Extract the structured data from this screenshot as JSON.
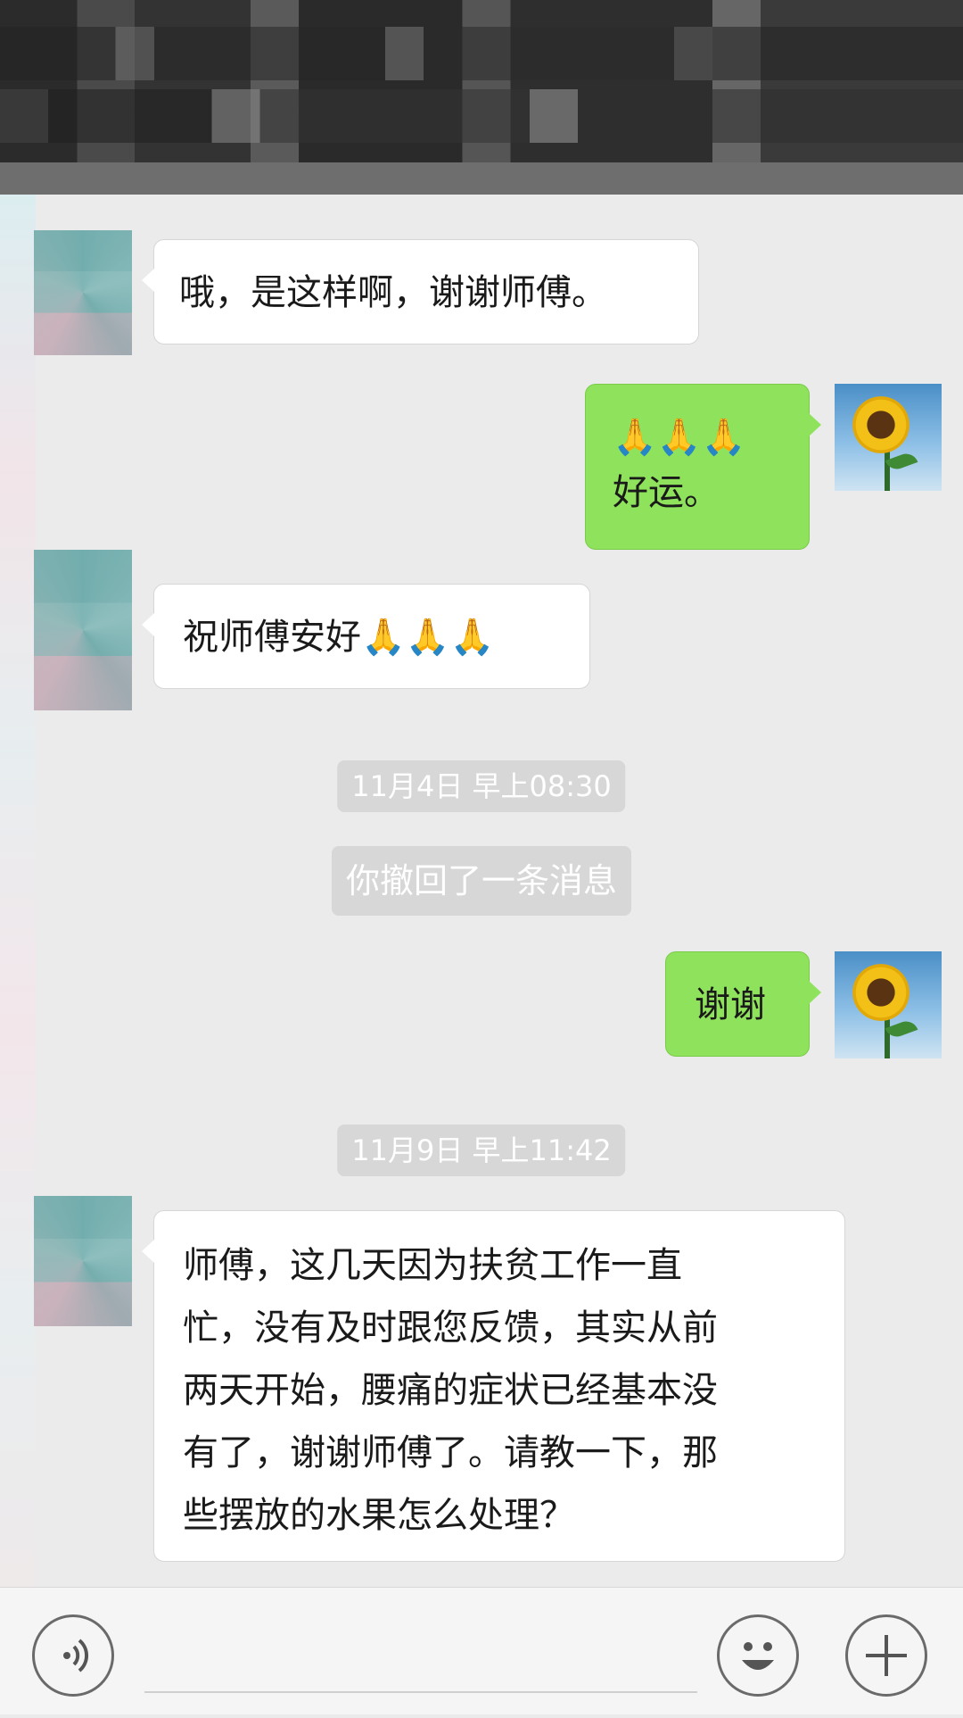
{
  "messages": [
    {
      "type": "received",
      "text": "哦，是这样啊，谢谢师傅。"
    },
    {
      "type": "sent",
      "line1": "🙏🙏🙏",
      "line2": "好运。"
    },
    {
      "type": "received",
      "text": "祝师傅安好",
      "emoji": "🙏🙏🙏"
    },
    {
      "type": "time",
      "text": "11月4日 早上08:30"
    },
    {
      "type": "system",
      "text": "你撤回了一条消息"
    },
    {
      "type": "sent",
      "text": "谢谢"
    },
    {
      "type": "time",
      "text": "11月9日 早上11:42"
    },
    {
      "type": "received",
      "lines": [
        "师傅，这几天因为扶贫工作一直",
        "忙，没有及时跟您反馈，其实从前",
        "两天开始，腰痛的症状已经基本没",
        "有了，谢谢师傅了。请教一下，那",
        "些摆放的水果怎么处理？"
      ]
    }
  ],
  "inputbar": {
    "voice_icon": "voice-icon",
    "emoji_icon": "emoji-face-icon",
    "plus_icon": "plus-icon"
  }
}
